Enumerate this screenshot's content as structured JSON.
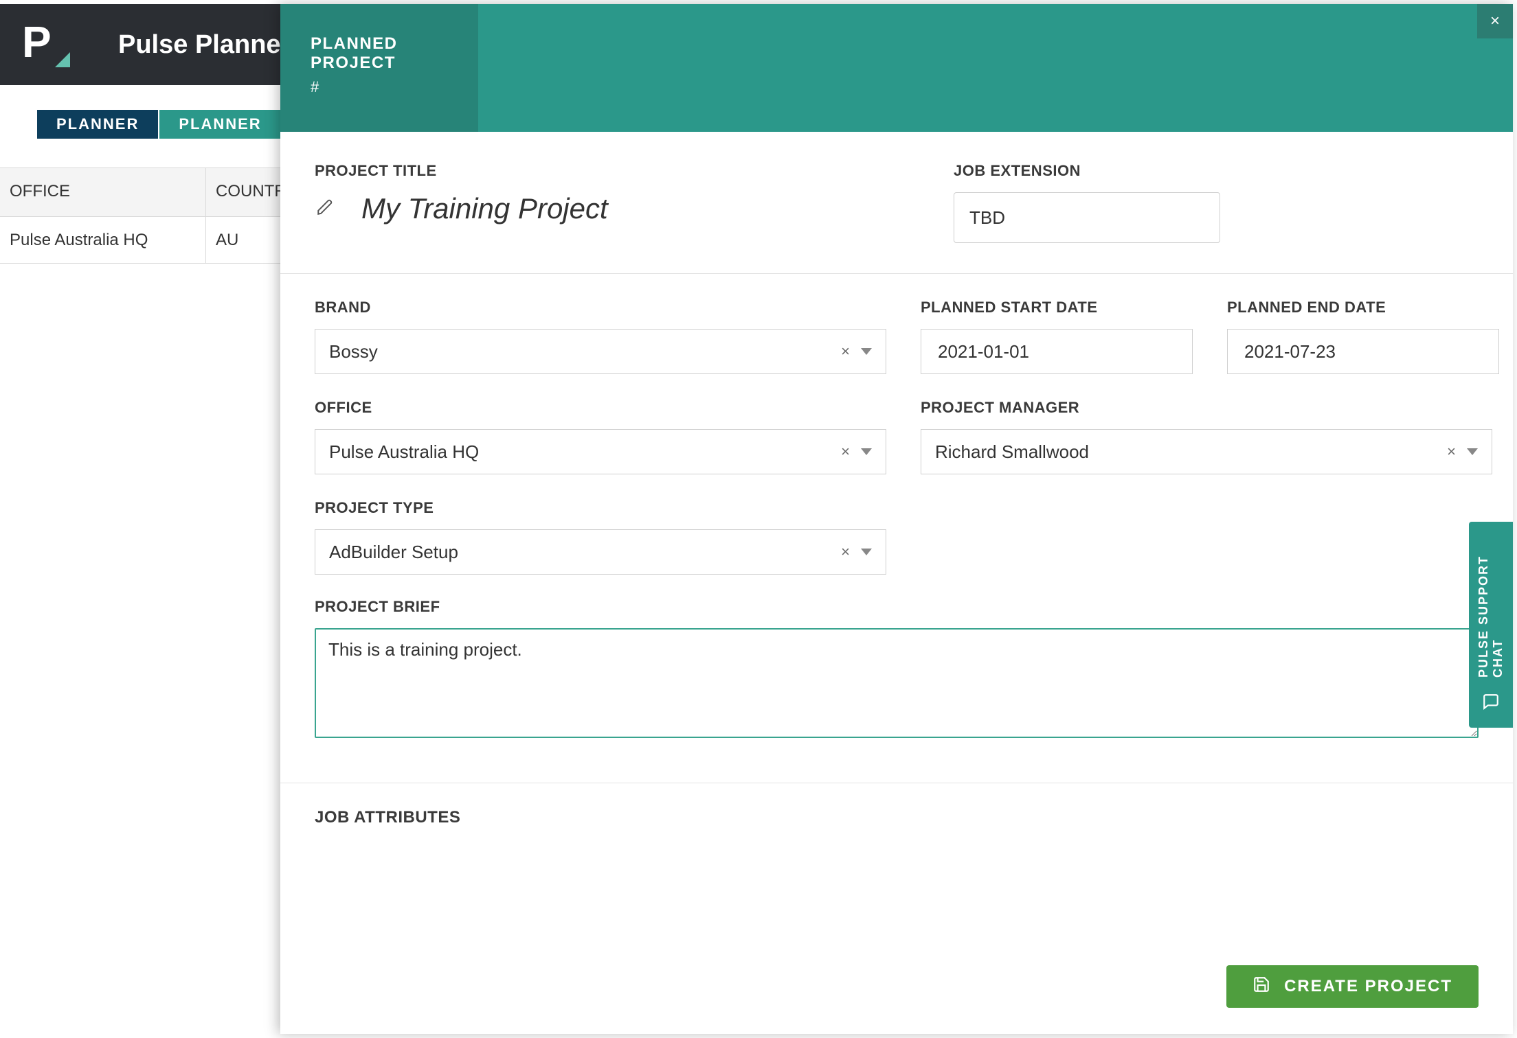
{
  "header": {
    "app_title": "Pulse Planne"
  },
  "tabs": [
    "PLANNER",
    "PLANNER"
  ],
  "background_table": {
    "headers": {
      "office": "OFFICE",
      "country": "COUNTRY"
    },
    "rows": [
      {
        "office": "Pulse Australia HQ",
        "country": "AU"
      }
    ]
  },
  "panel": {
    "heading": "PLANNED PROJECT",
    "subheading": "#",
    "fields": {
      "project_title_label": "PROJECT TITLE",
      "project_title_value": "My Training Project",
      "job_extension_label": "JOB EXTENSION",
      "job_extension_value": "TBD",
      "brand_label": "BRAND",
      "brand_value": "Bossy",
      "planned_start_label": "PLANNED START DATE",
      "planned_start_value": "2021-01-01",
      "planned_end_label": "PLANNED END DATE",
      "planned_end_value": "2021-07-23",
      "office_label": "OFFICE",
      "office_value": "Pulse Australia HQ",
      "project_manager_label": "PROJECT MANAGER",
      "project_manager_value": "Richard Smallwood",
      "project_type_label": "PROJECT TYPE",
      "project_type_value": "AdBuilder Setup",
      "project_brief_label": "PROJECT BRIEF",
      "project_brief_value": "This is a training project."
    },
    "job_attributes_label": "JOB ATTRIBUTES",
    "create_button": "CREATE PROJECT"
  },
  "support_tab": "PULSE SUPPORT CHAT",
  "icons": {
    "close": "×",
    "clear": "×"
  }
}
